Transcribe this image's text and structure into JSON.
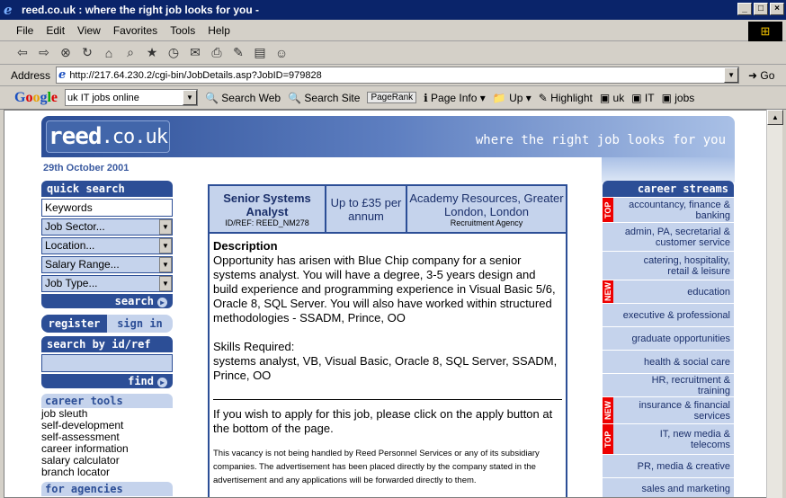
{
  "window": {
    "title": "reed.co.uk : where the right job looks for you -"
  },
  "menu": [
    "File",
    "Edit",
    "View",
    "Favorites",
    "Tools",
    "Help"
  ],
  "address": {
    "label": "Address",
    "url": "http://217.64.230.2/cgi-bin/JobDetails.asp?JobID=979828",
    "go": "Go"
  },
  "google": {
    "logo": "Google",
    "query": "uk IT jobs online",
    "search_web": "Search Web",
    "search_site": "Search Site",
    "pagerank": "PageRank",
    "page_info": "Page Info",
    "up": "Up",
    "highlight": "Highlight",
    "q1": "uk",
    "q2": "IT",
    "q3": "jobs"
  },
  "site": {
    "logo_main": "reed",
    "logo_dot": ".co.uk",
    "tagline": "where the right job looks for you",
    "date": "29th October 2001"
  },
  "left": {
    "quick_search": "quick search",
    "keywords": "Keywords",
    "sector": "Job Sector...",
    "location": "Location...",
    "salary": "Salary Range...",
    "jobtype": "Job Type...",
    "search_btn": "search",
    "register": "register",
    "signin": "sign in",
    "search_id": "search by id/ref",
    "find": "find",
    "career_tools": "career tools",
    "tools": [
      "job sleuth",
      "self-development",
      "self-assessment",
      "career information",
      "salary calculator",
      "branch locator"
    ],
    "for_agencies": "for agencies"
  },
  "job": {
    "title": "Senior Systems Analyst",
    "ref": "ID/REF: REED_NM278",
    "salary": "Up to £35 per annum",
    "agency": "Academy Resources, Greater London, London",
    "agency_type": "Recruitment Agency",
    "desc_head": "Description",
    "desc": "Opportunity has arisen with Blue Chip company for a senior systems analyst. You will have a degree, 3-5 years design and build experience and programming experience in Visual Basic 5/6, Oracle 8, SQL Server. You will also have worked within structured methodologies - SSADM, Prince, OO",
    "skills_head": "Skills Required:",
    "skills": "systems analyst, VB, Visual Basic, Oracle 8, SQL Server, SSADM, Prince, OO",
    "apply": "If you wish to apply for this job, please click on the apply button at the bottom of the page.",
    "disclaimer": "This vacancy is not being handled by Reed Personnel Services or any of its subsidiary companies. The advertisement has been placed directly by the company stated in the advertisement and any applications will be forwarded directly to them."
  },
  "streams": {
    "head": "career streams",
    "items": [
      {
        "label": "accountancy, finance & banking",
        "badge": "TOP"
      },
      {
        "label": "admin, PA, secretarial & customer service",
        "badge": ""
      },
      {
        "label": "catering, hospitality, retail & leisure",
        "badge": ""
      },
      {
        "label": "education",
        "badge": "NEW"
      },
      {
        "label": "executive & professional",
        "badge": ""
      },
      {
        "label": "graduate opportunities",
        "badge": ""
      },
      {
        "label": "health & social care",
        "badge": ""
      },
      {
        "label": "HR, recruitment & training",
        "badge": ""
      },
      {
        "label": "insurance & financial services",
        "badge": "NEW"
      },
      {
        "label": "IT, new media & telecoms",
        "badge": "TOP"
      },
      {
        "label": "PR, media & creative",
        "badge": ""
      },
      {
        "label": "sales and marketing",
        "badge": ""
      }
    ]
  }
}
